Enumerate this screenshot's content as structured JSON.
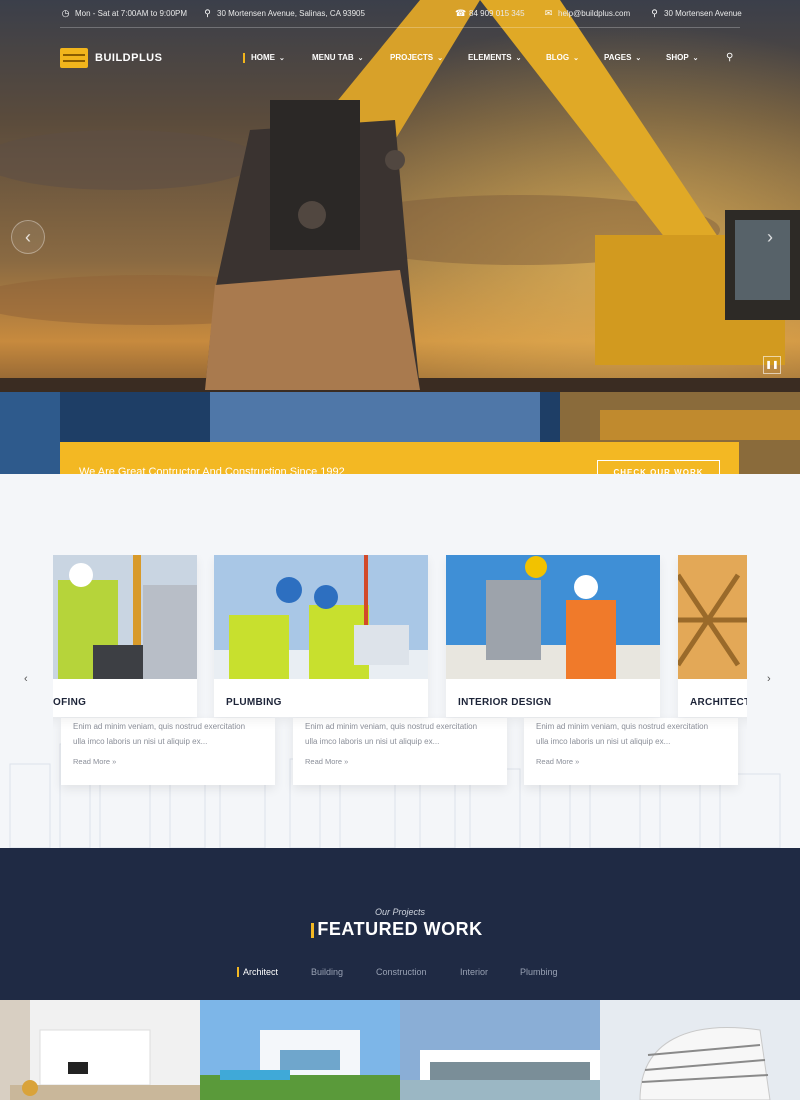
{
  "topbar": {
    "hours": "Mon - Sat at 7:00AM to 9:00PM",
    "address": "30 Mortensen Avenue, Salinas, CA 93905",
    "phone": "84 909 015 345",
    "email": "help@buildplus.com",
    "address_short": "30 Mortensen Avenue"
  },
  "brand": {
    "name": "BUILDPLUS",
    "accent": "#f3b823",
    "dark": "#1f2a44"
  },
  "nav": {
    "items": [
      {
        "label": "HOME"
      },
      {
        "label": "MENU TAB"
      },
      {
        "label": "PROJECTS"
      },
      {
        "label": "ELEMENTS"
      },
      {
        "label": "BLOG"
      },
      {
        "label": "PAGES"
      },
      {
        "label": "SHOP"
      }
    ]
  },
  "banner": {
    "text": "We Are Great Contructor And Construction Since 1992",
    "button": "CHECK OUR WORK"
  },
  "services": {
    "cards": [
      {
        "title": "ROOFING",
        "visible_title": "OFING"
      },
      {
        "title": "PLUMBING"
      },
      {
        "title": "INTERIOR DESIGN"
      },
      {
        "title": "ARCHITECT"
      }
    ],
    "desc_line1": "Enim ad minim veniam, quis nostrud exercitation",
    "desc_line2": "ulla imco laboris un nisi ut aliquip ex...",
    "read_more": "Read More »"
  },
  "featured": {
    "kicker": "Our Projects",
    "title": "FEATURED WORK",
    "filters": [
      {
        "label": "Architect"
      },
      {
        "label": "Building"
      },
      {
        "label": "Construction"
      },
      {
        "label": "Interior"
      },
      {
        "label": "Plumbing"
      }
    ]
  },
  "icons": [
    "clock-icon",
    "map-pin-icon",
    "phone-icon",
    "mail-icon",
    "search-icon",
    "chevron-left-icon",
    "chevron-right-icon"
  ]
}
